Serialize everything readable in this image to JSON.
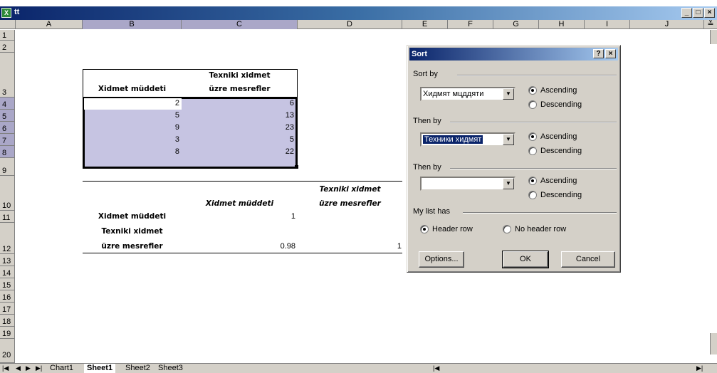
{
  "window": {
    "title": "tt",
    "app_icon": "excel-icon",
    "controls": [
      "_",
      "□",
      "×"
    ]
  },
  "columns": [
    "A",
    "B",
    "C",
    "D",
    "E",
    "F",
    "G",
    "H",
    "I",
    "J"
  ],
  "rows": [
    "1",
    "2",
    "3",
    "4",
    "5",
    "6",
    "7",
    "8",
    "9",
    "10",
    "11",
    "12",
    "13",
    "14",
    "15",
    "16",
    "17",
    "18",
    "19",
    "20"
  ],
  "table1": {
    "header_col1": "Xidmet müddeti",
    "header_col2_line1": "Texniki xidmet",
    "header_col2_line2": "üzre mesrefler",
    "data": [
      {
        "b": "2",
        "c": "6"
      },
      {
        "b": "5",
        "c": "13"
      },
      {
        "b": "9",
        "c": "23"
      },
      {
        "b": "3",
        "c": "5"
      },
      {
        "b": "8",
        "c": "22"
      }
    ]
  },
  "table2": {
    "col_c_header": "Xidmet müddeti",
    "col_d_header_line1": "Texniki xidmet",
    "col_d_header_line2": "üzre mesrefler",
    "row11_label": "Xidmet müddeti",
    "row11_c": "1",
    "row12_label_line1": "Texniki xidmet",
    "row12_label_line2": "üzre mesrefler",
    "row12_c": "0.98",
    "row12_d": "1"
  },
  "tabs": [
    "Chart1",
    "Sheet1",
    "Sheet2",
    "Sheet3"
  ],
  "active_tab": "Sheet1",
  "dialog": {
    "title": "Sort",
    "help": "?",
    "close": "×",
    "sort_by": {
      "label": "Sort by",
      "value": "Хидмят мцддяти",
      "asc": "Ascending",
      "desc": "Descending",
      "selected": "Ascending"
    },
    "then_by_1": {
      "label": "Then by",
      "value": "Техники хидмят",
      "asc": "Ascending",
      "desc": "Descending",
      "selected": "Ascending"
    },
    "then_by_2": {
      "label": "Then by",
      "value": "",
      "asc": "Ascending",
      "desc": "Descending",
      "selected": "Ascending"
    },
    "my_list_has": {
      "label": "My list has",
      "header_row": "Header row",
      "no_header_row": "No header row",
      "selected": "Header row"
    },
    "buttons": {
      "options": "Options...",
      "ok": "OK",
      "cancel": "Cancel"
    }
  },
  "colors": {
    "selection": "#aaa7c8",
    "titlebar": "#0a246a",
    "chrome": "#d4d0c8"
  }
}
